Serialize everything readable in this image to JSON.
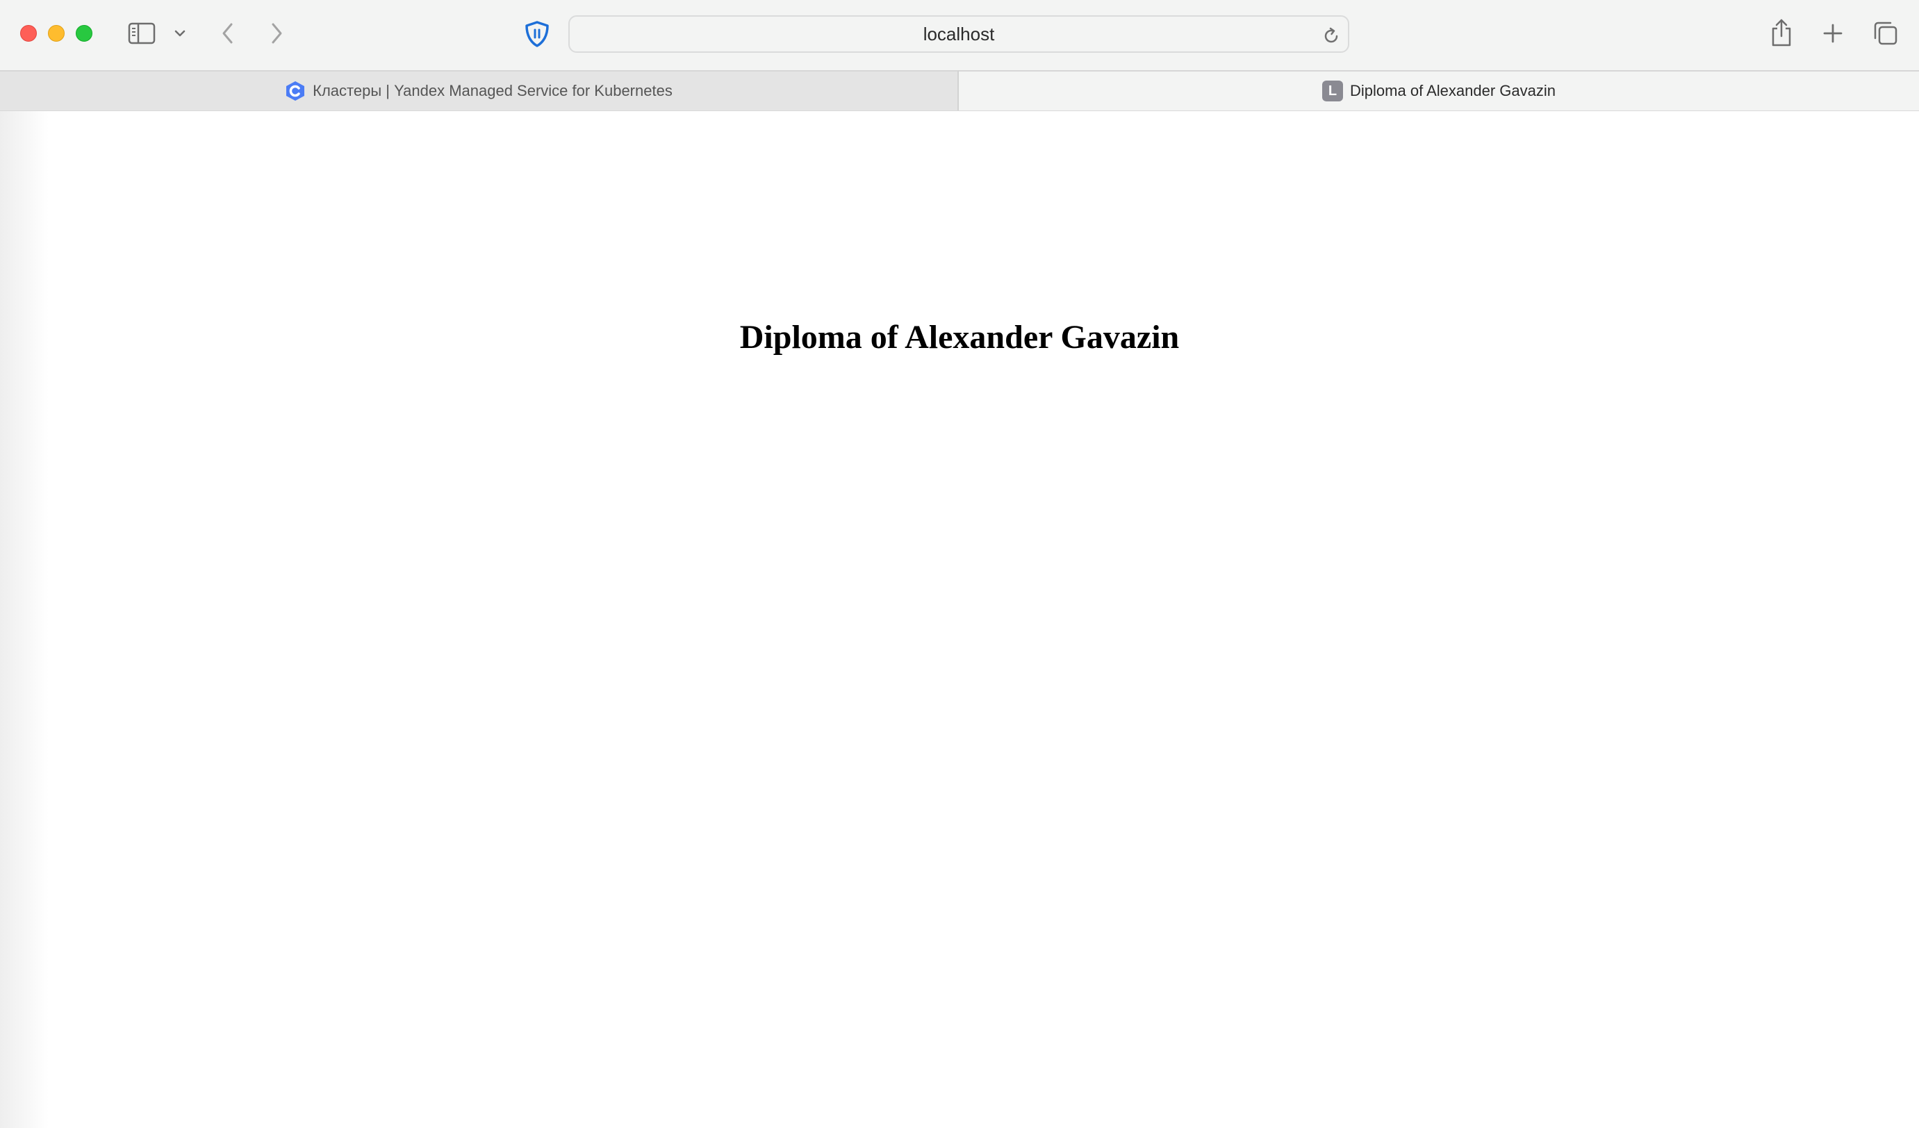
{
  "window": {
    "controls": [
      "close",
      "minimize",
      "maximize"
    ]
  },
  "toolbar": {
    "sidebar_icon": "sidebar-icon",
    "sidebar_menu_icon": "chevron-down-icon",
    "back_icon": "chevron-left-icon",
    "forward_icon": "chevron-right-icon",
    "privacy_icon": "shield-icon",
    "reload_icon": "reload-icon",
    "share_icon": "share-icon",
    "new_tab_icon": "plus-icon",
    "tab_overview_icon": "tabs-overview-icon",
    "accent_color": "#1d6fd8"
  },
  "address_bar": {
    "url": "localhost"
  },
  "tabs": [
    {
      "label": "Кластеры | Yandex Managed Service for Kubernetes",
      "favicon": "yandex-cloud-icon",
      "active": false
    },
    {
      "label": "Diploma of Alexander Gavazin",
      "favicon_letter": "L",
      "active": true
    }
  ],
  "page": {
    "heading": "Diploma of Alexander Gavazin"
  }
}
